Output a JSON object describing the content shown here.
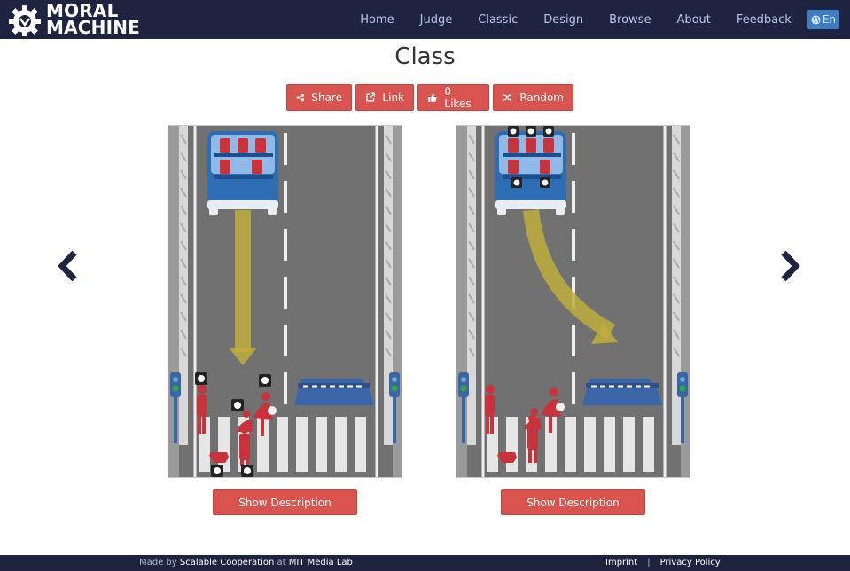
{
  "brand": {
    "line1": "MORAL",
    "line2": "MACHINE"
  },
  "nav": {
    "items": [
      "Home",
      "Judge",
      "Classic",
      "Design",
      "Browse",
      "About",
      "Feedback"
    ],
    "language": "En"
  },
  "page": {
    "title": "Class"
  },
  "actions": {
    "share": "Share",
    "link": "Link",
    "likes": "0 Likes",
    "random": "Random"
  },
  "scenarios": [
    {
      "description_button": "Show Description"
    },
    {
      "description_button": "Show Description"
    }
  ],
  "footer": {
    "made_by": "Made by",
    "team": "Scalable Cooperation",
    "at": "at",
    "lab": "MIT Media Lab",
    "imprint": "Imprint",
    "separator": "|",
    "privacy": "Privacy Policy"
  },
  "colors": {
    "navbar": "#1e2340",
    "button": "#d9534f",
    "road": "#717171",
    "car": "#2d6db4",
    "barrier": "#3a66a8",
    "person": "#c8323c",
    "path_arrow": "#bfae3c"
  }
}
